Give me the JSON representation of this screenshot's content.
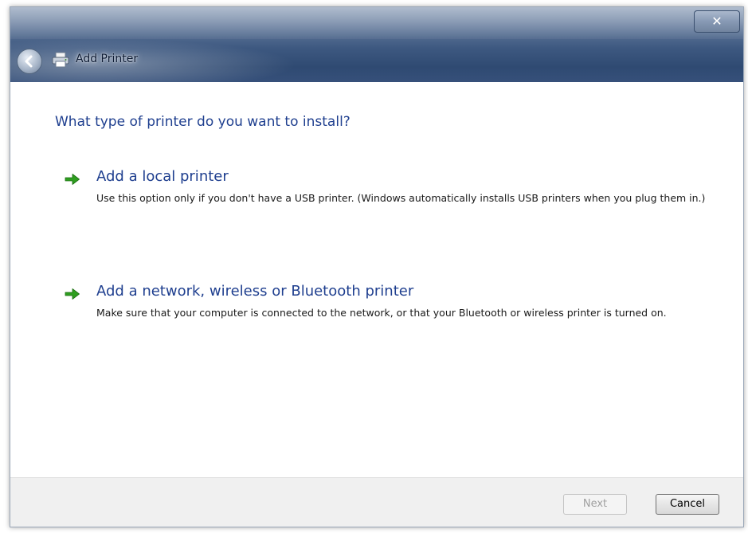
{
  "window": {
    "title": "Add Printer",
    "close_label": "✕",
    "colors": {
      "titlebar_top": "#8497b3",
      "titlebar_bottom": "#2f4a72",
      "heading_blue": "#1f3f8f",
      "arrow_green": "#2e9e1f"
    }
  },
  "icons": {
    "back": "back-arrow-icon",
    "printer": "printer-icon",
    "option_arrow": "green-arrow-icon"
  },
  "main": {
    "heading": "What type of printer do you want to install?",
    "options": [
      {
        "title": "Add a local printer",
        "description": "Use this option only if you don't have a USB printer. (Windows automatically installs USB printers when you plug them in.)"
      },
      {
        "title": "Add a network, wireless or Bluetooth printer",
        "description": "Make sure that your computer is connected to the network, or that your Bluetooth or wireless printer is turned on."
      }
    ]
  },
  "footer": {
    "next_label": "Next",
    "next_enabled": false,
    "cancel_label": "Cancel"
  }
}
